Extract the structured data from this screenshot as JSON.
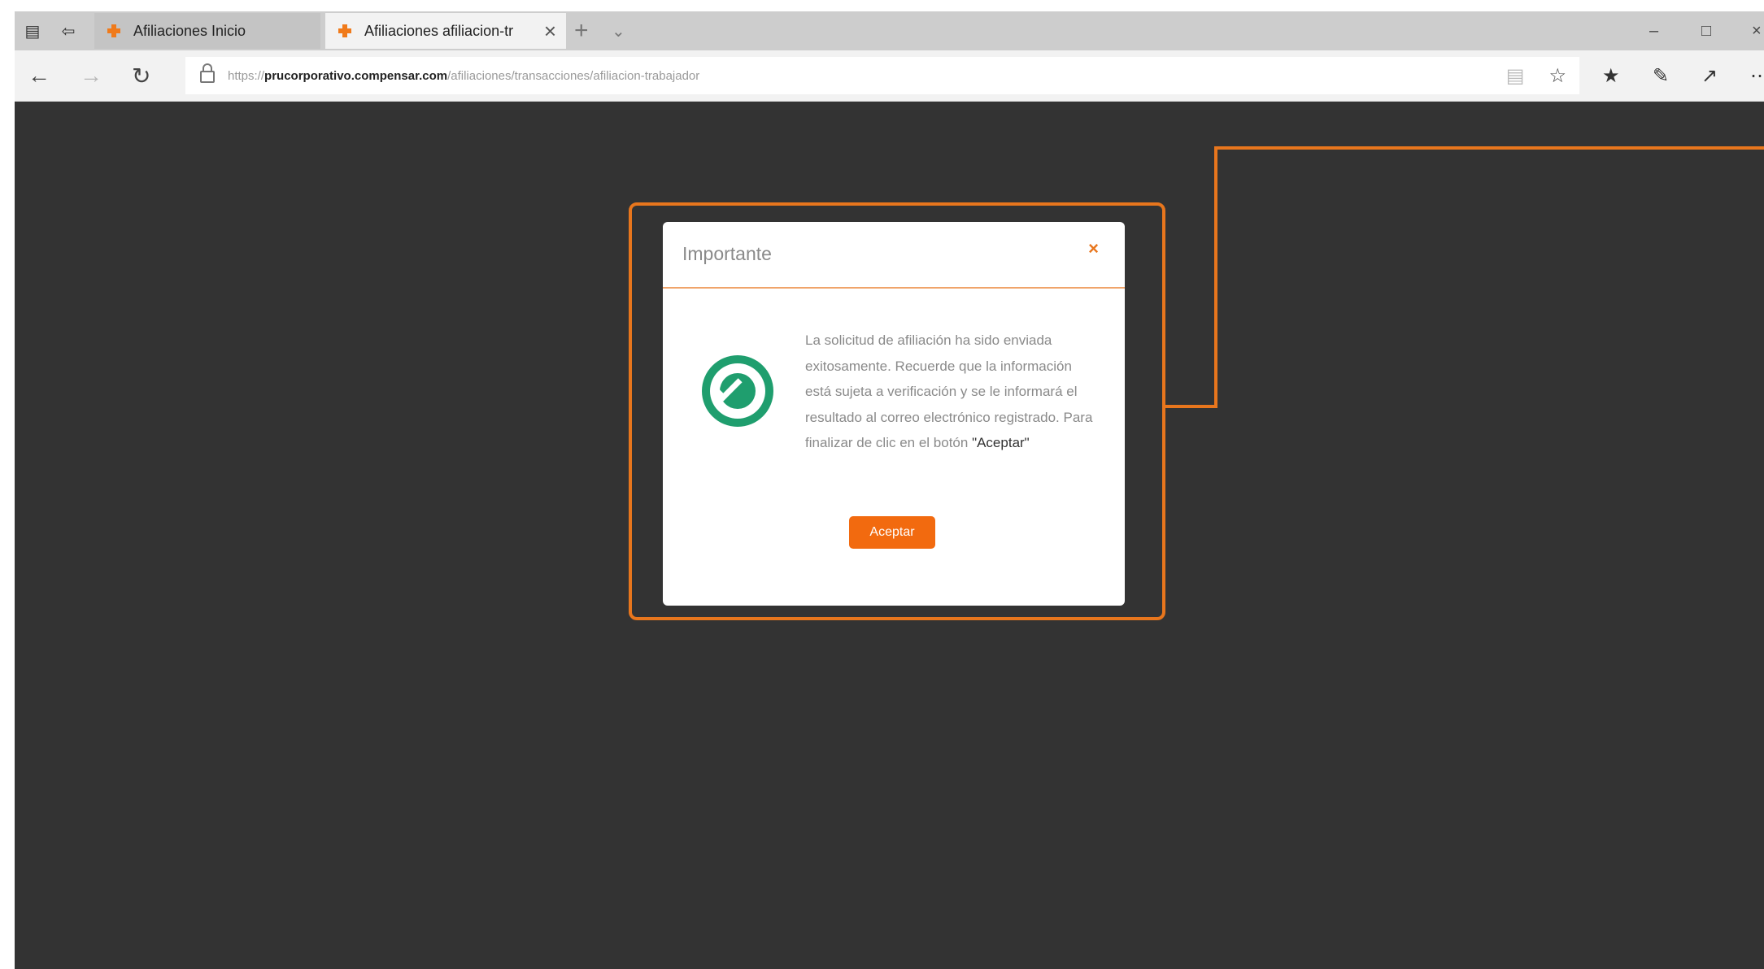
{
  "browser": {
    "tabs": [
      {
        "label": "Afiliaciones Inicio",
        "active": false
      },
      {
        "label": "Afiliaciones afiliacion-tr",
        "active": true
      }
    ],
    "new_tab_label": "+",
    "address": {
      "scheme": "https://",
      "domain": "prucorporativo.compensar.com",
      "path": "/afiliaciones/transacciones/afiliacion-trabajador"
    }
  },
  "modal": {
    "title": "Importante",
    "message": "La solicitud de afiliación ha sido enviada exitosamente. Recuerde que la información está sujeta a verificación y se le informará el resultado al correo electrónico registrado. Para finalizar de clic en el botón ",
    "message_emphasis": "\"Aceptar\"",
    "accept_label": "Aceptar"
  },
  "colors": {
    "accent": "#e8761d",
    "button": "#f26a0f",
    "success": "#1f9e6e",
    "page_background": "#333333"
  },
  "icons": [
    "tab-actions-icon",
    "set-aside-tabs-icon",
    "site-favicon",
    "close-tab-icon",
    "new-tab-icon",
    "tab-list-icon",
    "minimize-icon",
    "maximize-icon",
    "close-window-icon",
    "back-icon",
    "forward-icon",
    "refresh-icon",
    "lock-icon",
    "reading-view-icon",
    "favorite-star-icon",
    "favorites-list-icon",
    "notes-icon",
    "share-icon",
    "more-icon",
    "check-circle-icon",
    "close-icon"
  ]
}
